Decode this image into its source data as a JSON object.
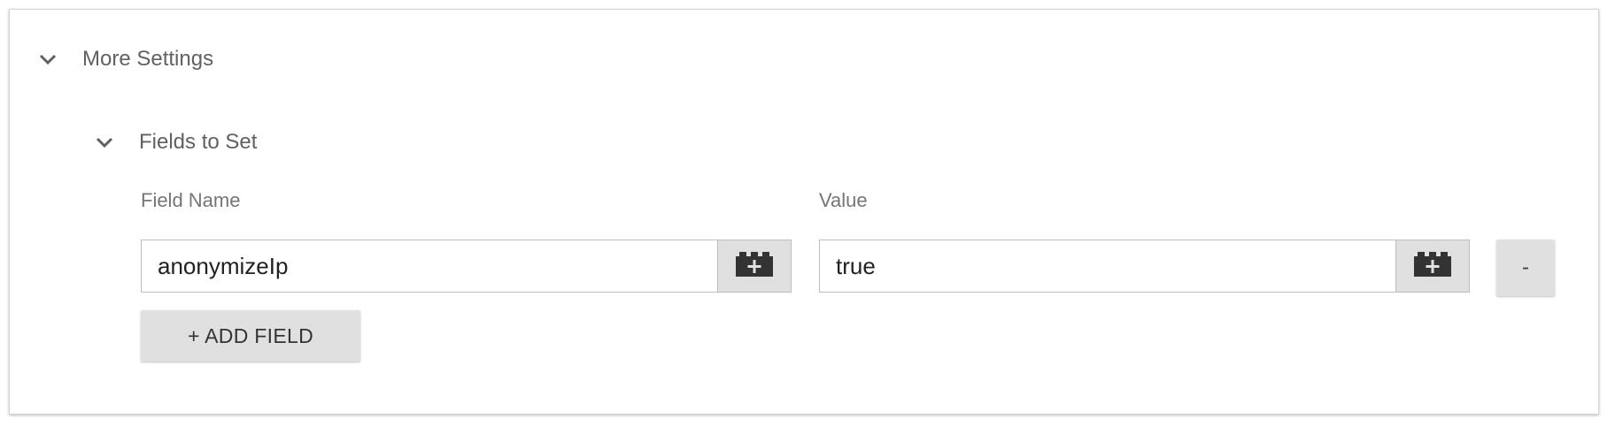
{
  "more_settings": {
    "title": "More Settings",
    "icon": "chevron-down-icon"
  },
  "fields_to_set": {
    "title": "Fields to Set",
    "icon": "chevron-down-icon",
    "columns": {
      "name_label": "Field Name",
      "value_label": "Value"
    },
    "rows": [
      {
        "field_name": "anonymizeIp",
        "value": "true",
        "remove_label": "-"
      }
    ],
    "add_field_label": "+ ADD FIELD"
  },
  "colors": {
    "text_primary": "#212121",
    "text_secondary": "#616161",
    "button_bg": "#e0e0e0",
    "border": "#bdbdbd"
  }
}
